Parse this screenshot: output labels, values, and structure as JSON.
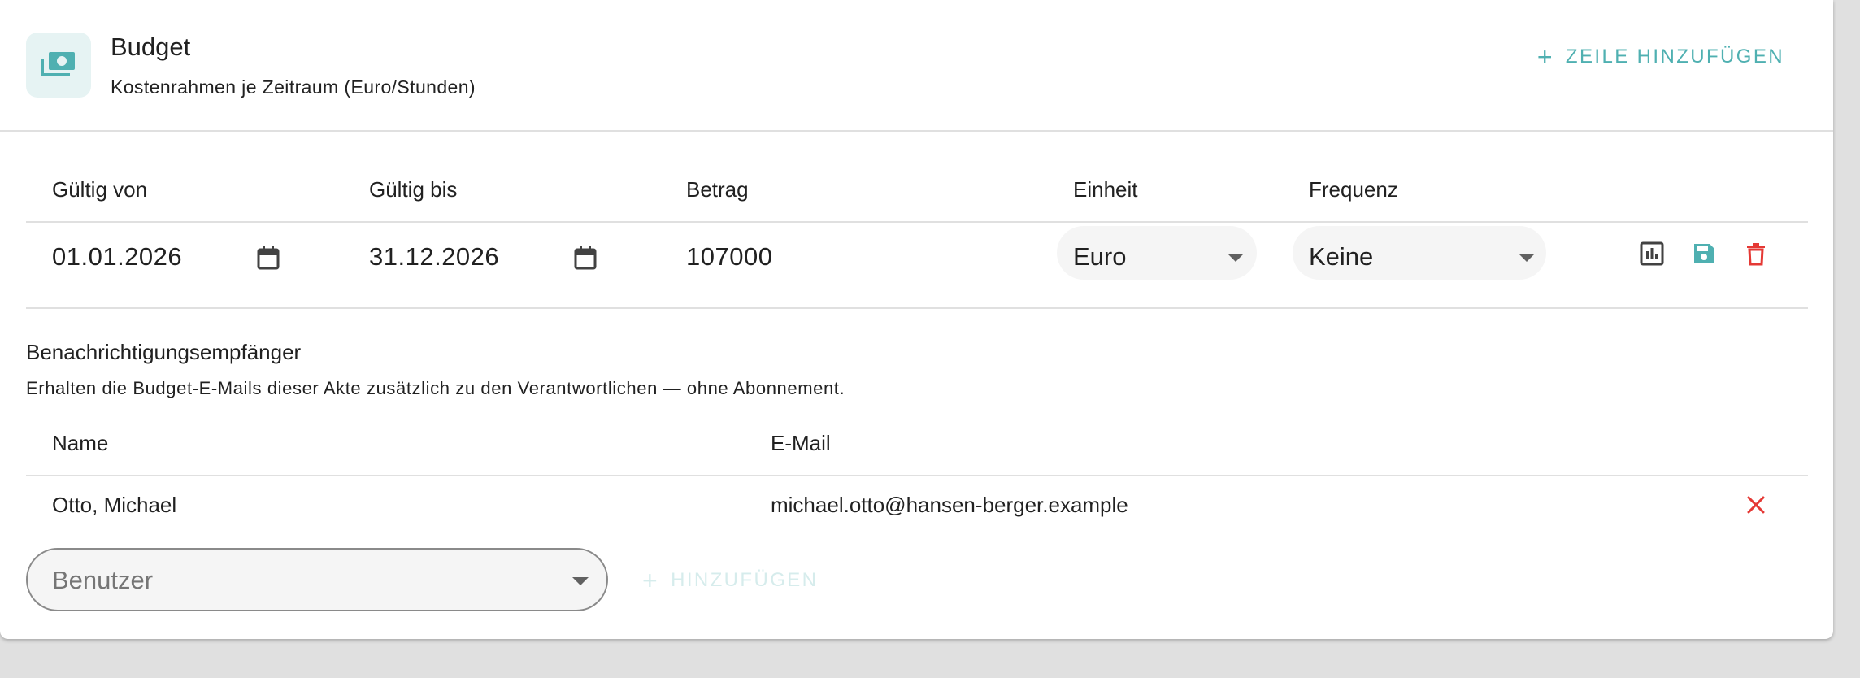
{
  "header": {
    "title": "Budget",
    "subtitle": "Kostenrahmen je Zeitraum (Euro/Stunden)",
    "add_row_label": "ZEILE HINZUFÜGEN",
    "icon": "money-icon"
  },
  "budget_table": {
    "columns": [
      "Gültig von",
      "Gültig bis",
      "Betrag",
      "Einheit",
      "Frequenz"
    ],
    "rows": [
      {
        "valid_from": "01.01.2026",
        "valid_to": "31.12.2026",
        "amount": "107000",
        "unit": "Euro",
        "frequency": "Keine"
      }
    ]
  },
  "notifications": {
    "title": "Benachrichtigungsempfänger",
    "description": "Erhalten die Budget-E-Mails dieser Akte zusätzlich zu den Verantwortlichen — ohne Abonnement.",
    "columns": [
      "Name",
      "E-Mail"
    ],
    "rows": [
      {
        "name": "Otto, Michael",
        "email": "michael.otto@hansen-berger.example"
      }
    ],
    "user_select_placeholder": "Benutzer",
    "add_label": "HINZUFÜGEN"
  },
  "colors": {
    "accent": "#4fb0b1",
    "danger": "#e53935",
    "disabled_accent": "#d6ecec"
  }
}
